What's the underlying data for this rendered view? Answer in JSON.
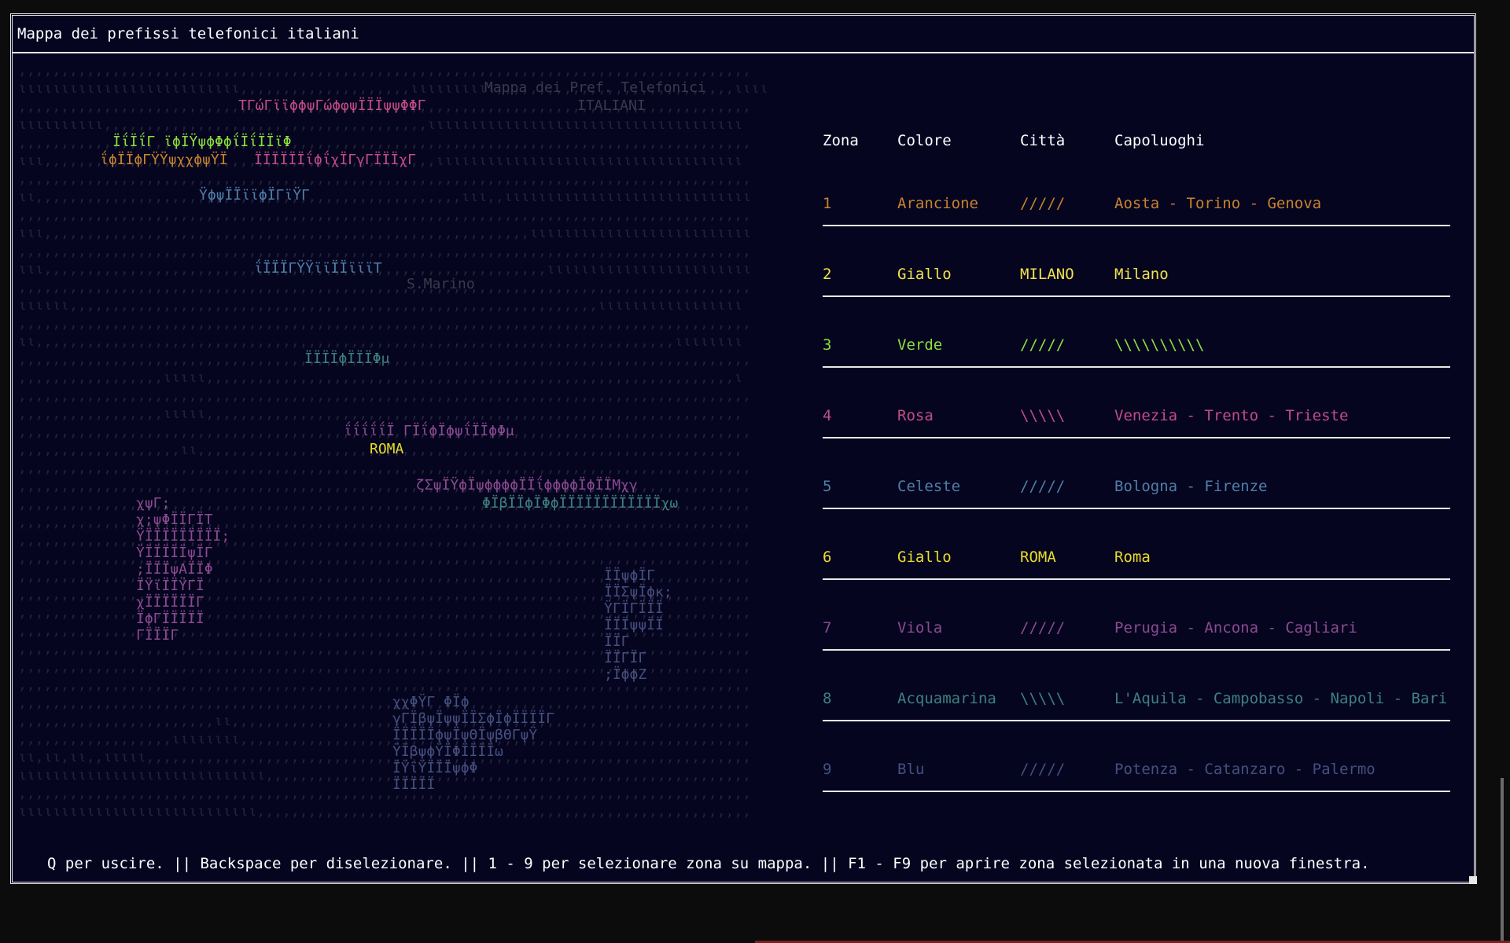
{
  "window": {
    "title": "Mappa dei prefissi telefonici italiani"
  },
  "map": {
    "heading": "Mappa dei Pref. Telefonici",
    "subheading": "ITALIANI",
    "label_sanmarino": "S.Marino",
    "label_roma": "ROMA",
    "regions": {
      "nw": "ΐϕΪΪϕΓΫΫψχχϕψΫΪ",
      "north": "ΤΓώΓϊϊϕϕψΓώϕφψΪΪΪψψΦΦΓ",
      "lombardy": "ΪΐΪΐΓ ϊϕΪΫψϕΦϕΐΪΐΪΪϊΦ",
      "veneto": "ΪΪΪΪΪΪΐϕΐχΪΓγΓΪΪΪχΓ",
      "emilia": "ΫϕψΪΪϊϊϕΪΓϊΫΓ",
      "tuscany": "ΐΪΪΪΓΫΫϊϊΪΪϊϊϊΤ",
      "center": "ΪΪΪΪϕΪΪΪΦμ",
      "lazio": "ΐΐΐΐΐΪ ΓΪΐϕΪϕψΐΪΪϕΦμ",
      "south": "ζΣψΪΫϕΪψϕϕϕϕΪΪΐϕϕϕϕΪϕΪΪΜχγ",
      "apulia": "ΦΪβΪΪϕΪΦϕΪΪΪΪΪΪΪΪΪΪΪΪχω",
      "sardinia": "χψΓ;\nχ;ψΦΪΪΓΪΤ\nΫΪΪΪΪΪΪΪΪΪ;\nΫΪΪΪΪΪψΪΓ\n;ΪΪΪψΑΪΪΦ\nΪΫϊΪΪΫΓΪ\nχΪΪΪΪΪΪΓ\nΪϕΓΪΪΪΪΪ\nΓΪΪΪΓ",
      "calabria": "ΪΪψϕΪΓ\nΪΪΣψΪϕκ;\nΫΓΪΓΪΪΪ\nΪΪΪψψΪΪ\nΪΪΓ\nΪΪΓΪΓ\n;ΪϕϕΖ",
      "sicily": "χχΦΫΓ ΦΪϕ\nγΓΪβψΪψψΪΪΣϕΪϕΪΪΪΪΓ\nΪΪΪΪΪϕψΪψΘΪψβΘΓψΫ\nΫΪβψϕΫΪΦΪΪΪΪω\nΪΫϊΫΪΪΪψϕΦ\nΪΪΪΪΪ"
    }
  },
  "table": {
    "headers": [
      "Zona",
      "Colore",
      "Città",
      "Capoluoghi"
    ],
    "rows": [
      {
        "zona": "1",
        "colore": "Arancione",
        "citta": "/////",
        "capoluoghi": "Aosta - Torino - Genova",
        "color": "#c8822d"
      },
      {
        "zona": "2",
        "colore": "Giallo",
        "citta": "MILANO",
        "capoluoghi": "Milano",
        "color": "#f0e24a"
      },
      {
        "zona": "3",
        "colore": "Verde",
        "citta": "/////",
        "capoluoghi": "\\\\\\\\\\\\\\\\\\\\",
        "color": "#8ce03a"
      },
      {
        "zona": "4",
        "colore": "Rosa",
        "citta": "\\\\\\\\\\",
        "capoluoghi": "Venezia - Trento - Trieste",
        "color": "#c24c86"
      },
      {
        "zona": "5",
        "colore": "Celeste",
        "citta": "/////",
        "capoluoghi": "Bologna - Firenze",
        "color": "#4f7fa8"
      },
      {
        "zona": "6",
        "colore": "Giallo",
        "citta": "ROMA",
        "capoluoghi": "Roma",
        "color": "#e8dc2a"
      },
      {
        "zona": "7",
        "colore": "Viola",
        "citta": "/////",
        "capoluoghi": "Perugia - Ancona - Cagliari",
        "color": "#8c4a90"
      },
      {
        "zona": "8",
        "colore": "Acquamarina",
        "citta": "\\\\\\\\\\",
        "capoluoghi": "L'Aquila - Campobasso - Napoli - Bari",
        "color": "#3e8080"
      },
      {
        "zona": "9",
        "colore": "Blu",
        "citta": "/////",
        "capoluoghi": "Potenza - Catanzaro - Palermo",
        "color": "#45507e"
      }
    ]
  },
  "status_bar": "Q per uscire. || Backspace per diselezionare. || 1 - 9 per selezionare zona su mappa. || F1 - F9 per aprire zona selezionata in una nuova finestra."
}
